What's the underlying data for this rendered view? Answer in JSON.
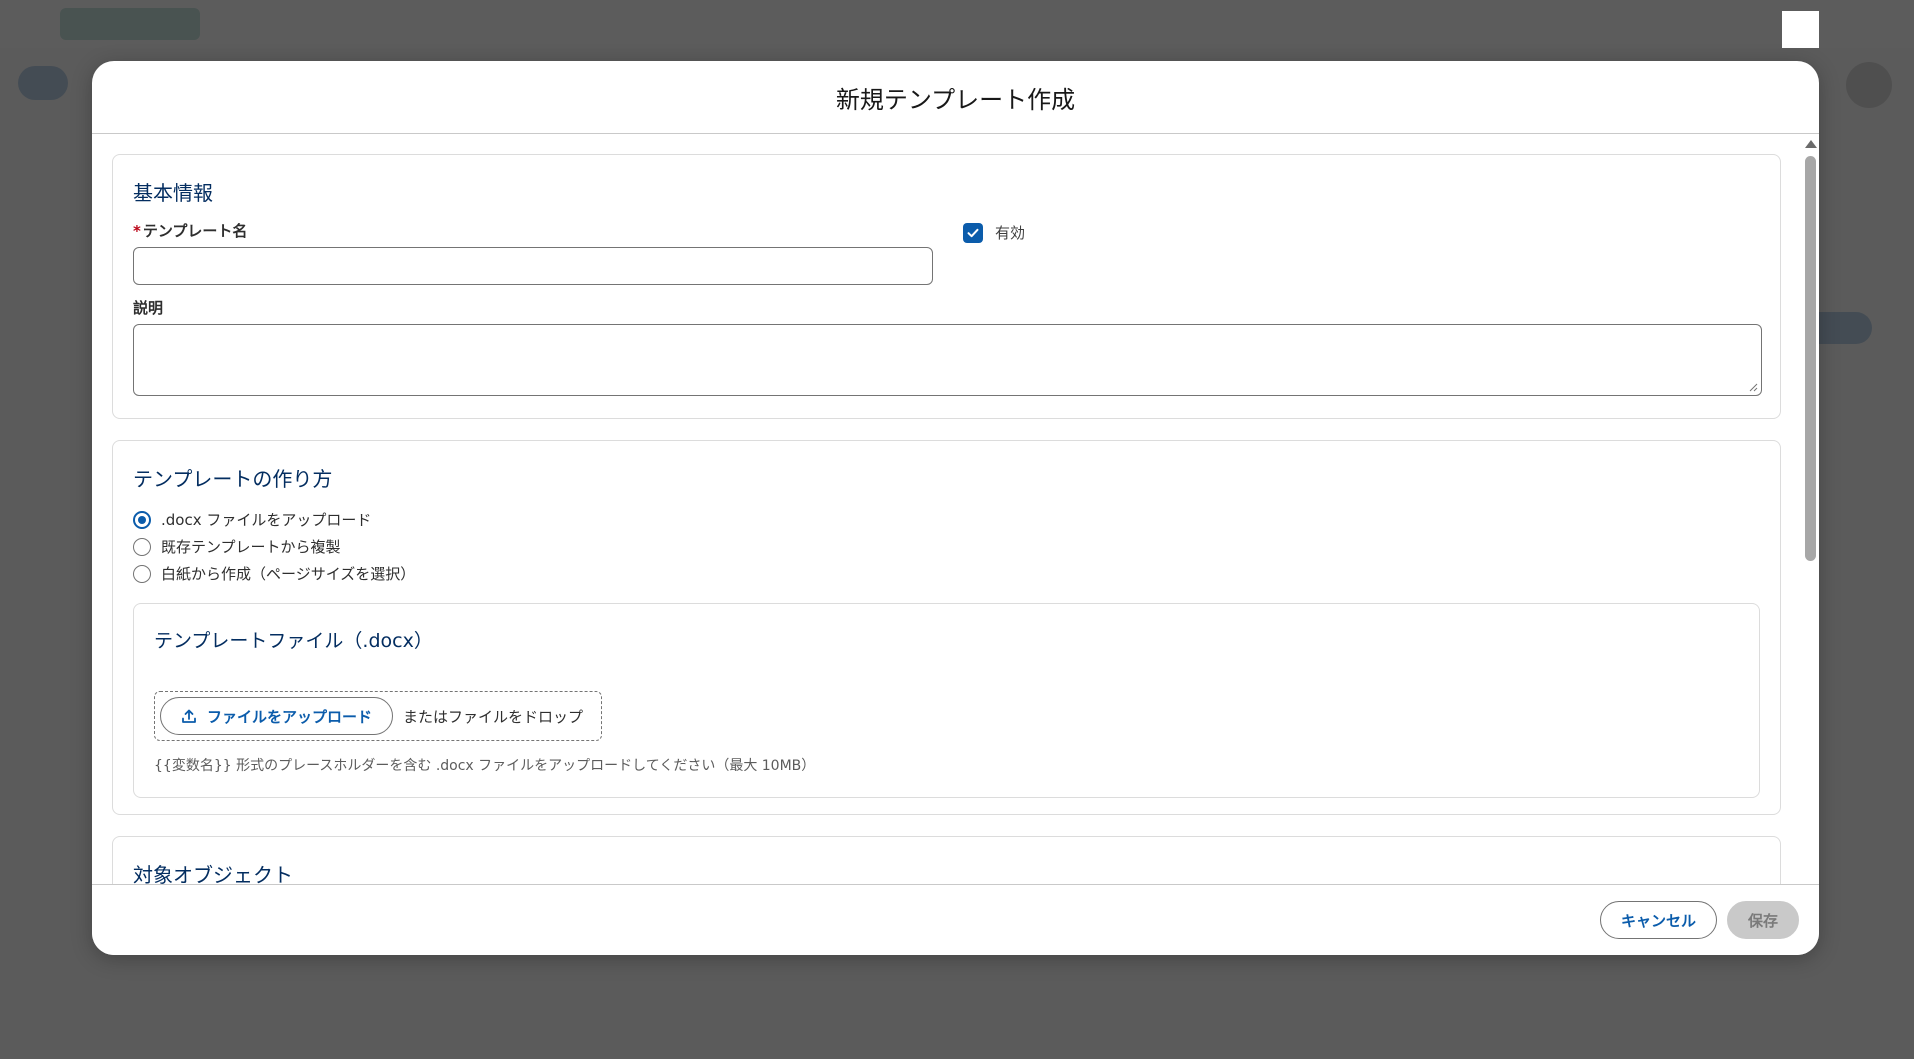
{
  "modal": {
    "title": "新規テンプレート作成"
  },
  "basic_info": {
    "section_title": "基本情報",
    "template_name_label": "テンプレート名",
    "required_mark": "*",
    "template_name_value": "",
    "active_label": "有効",
    "active_checked": true,
    "description_label": "説明",
    "description_value": ""
  },
  "creation_method": {
    "section_title": "テンプレートの作り方",
    "options": [
      {
        "label": ".docx ファイルをアップロード",
        "checked": true
      },
      {
        "label": "既存テンプレートから複製",
        "checked": false
      },
      {
        "label": "白紙から作成（ページサイズを選択）",
        "checked": false
      }
    ],
    "file_card": {
      "title": "テンプレートファイル（.docx）",
      "upload_button": "ファイルをアップロード",
      "drop_text": "またはファイルをドロップ",
      "help_text": "{{変数名}} 形式のプレースホルダーを含む .docx ファイルをアップロードしてください（最大 10MB）"
    }
  },
  "target_object": {
    "section_title": "対象オブジェクト"
  },
  "footer": {
    "cancel_label": "キャンセル",
    "save_label": "保存"
  },
  "colors": {
    "brand": "#0b5cab",
    "heading": "#032d60",
    "required": "#ba0517"
  }
}
